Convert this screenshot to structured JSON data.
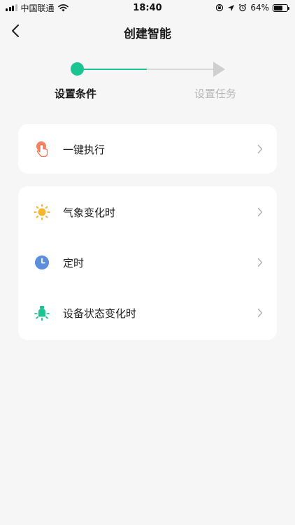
{
  "status_bar": {
    "carrier": "中国联通",
    "time": "18:40",
    "battery_percent": "64%",
    "battery_level": 0.64
  },
  "header": {
    "title": "创建智能",
    "back_icon": "chevron-left-icon"
  },
  "stepper": {
    "steps": [
      {
        "label": "设置条件",
        "active": true
      },
      {
        "label": "设置任务",
        "active": false
      }
    ],
    "active_color": "#1ac592",
    "inactive_color": "#cfcfcf"
  },
  "conditions": {
    "manual": [
      {
        "label": "一键执行",
        "icon": "tap-hand-icon",
        "color": "#f27451"
      }
    ],
    "auto": [
      {
        "label": "气象变化时",
        "icon": "sun-icon",
        "color": "#f7b52c"
      },
      {
        "label": "定时",
        "icon": "clock-icon",
        "color": "#5b8fdd"
      },
      {
        "label": "设备状态变化时",
        "icon": "device-light-icon",
        "color": "#1ac592"
      }
    ]
  }
}
